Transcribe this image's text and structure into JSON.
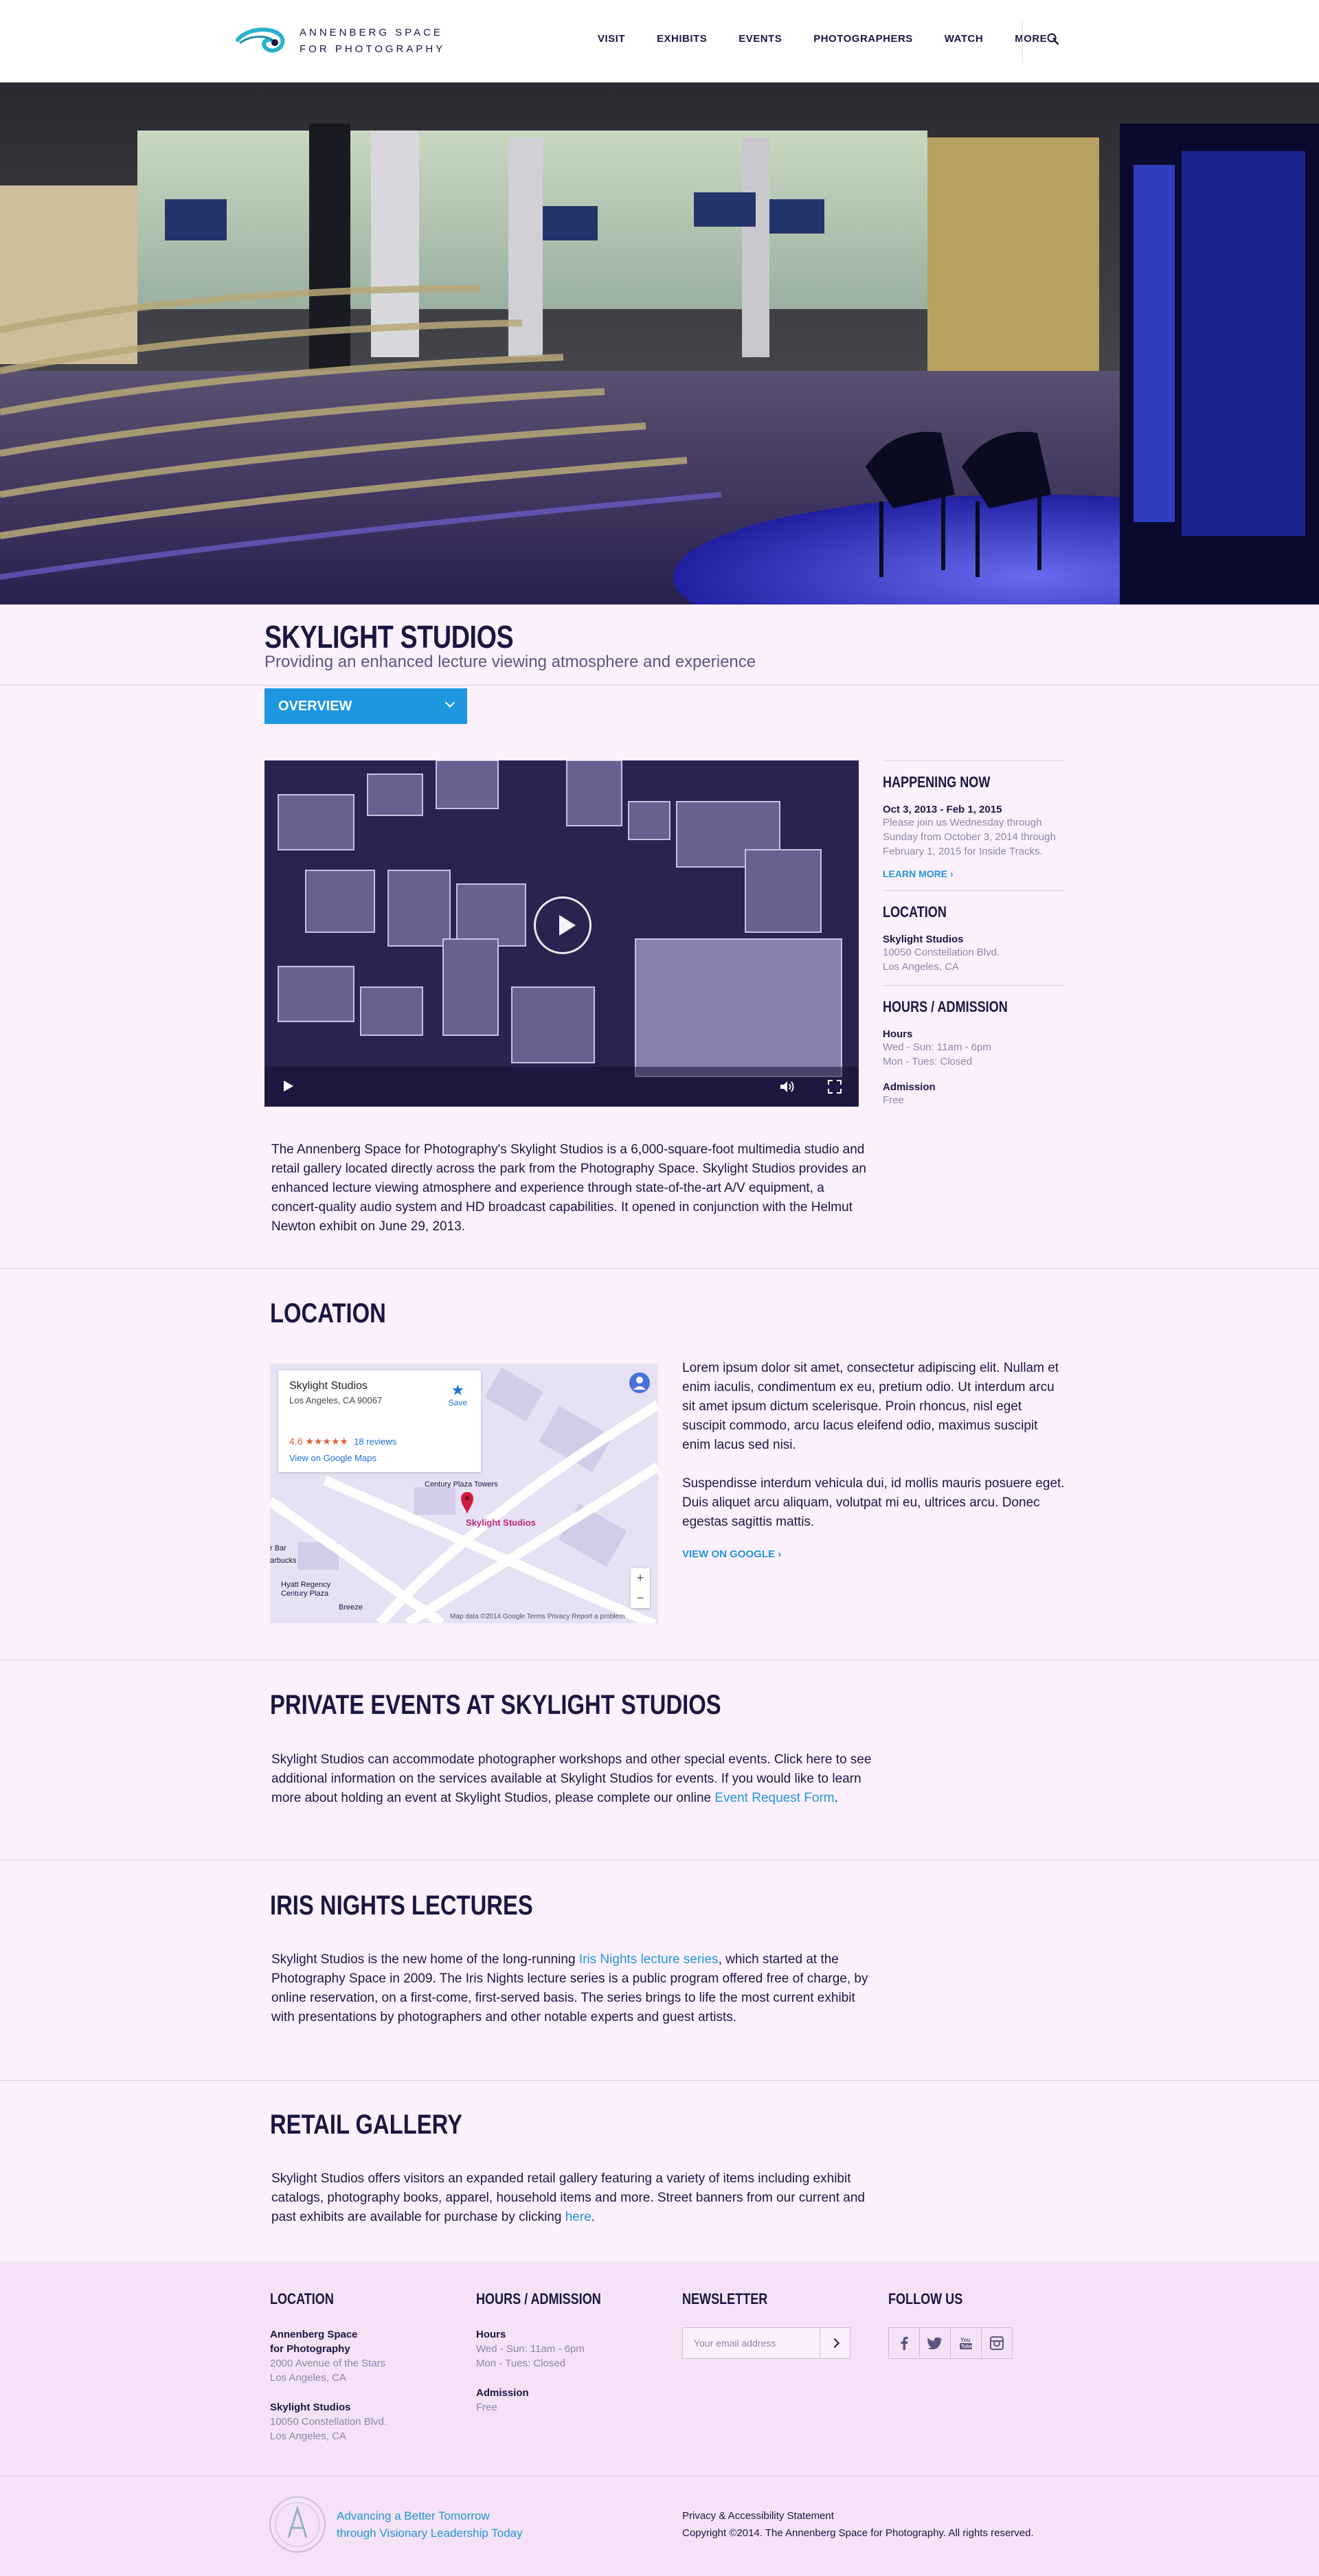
{
  "header": {
    "logo_line1": "ANNENBERG SPACE",
    "logo_line2": "FOR PHOTOGRAPHY",
    "nav": [
      "VISIT",
      "EXHIBITS",
      "EVENTS",
      "PHOTOGRAPHERS",
      "WATCH",
      "MORE"
    ],
    "icons": [
      "chevron-down-icon",
      "search-icon"
    ]
  },
  "page": {
    "title": "SKYLIGHT STUDIOS",
    "subtitle": "Providing an enhanced lecture viewing atmosphere and experience",
    "section_select": "OVERVIEW",
    "intro": "The Annenberg Space for Photography's Skylight Studios is a 6,000-square-foot multimedia studio and retail gallery located directly across the park from the Photography Space. Skylight Studios provides an enhanced lecture viewing atmosphere and experience through state-of-the-art A/V equipment, a concert-quality audio system and HD broadcast capabilities.  It opened in conjunction with the Helmut Newton exhibit on June 29, 2013."
  },
  "video": {
    "icons": [
      "play-icon",
      "volume-icon",
      "fullscreen-icon"
    ]
  },
  "sidebar": {
    "happening": {
      "heading": "HAPPENING NOW",
      "dates": "Oct 3, 2013 - Feb 1, 2015",
      "text": "Please join us Wednesday through Sunday from October 3, 2014 through February 1, 2015 for Inside Tracks.",
      "link": "LEARN MORE"
    },
    "location": {
      "heading": "LOCATION",
      "name": "Skylight Studios",
      "addr1": "10050 Constellation Blvd.",
      "addr2": "Los Angeles, CA"
    },
    "hours": {
      "heading": "HOURS / ADMISSION",
      "hours_label": "Hours",
      "hours1": "Wed - Sun: 11am - 6pm",
      "hours2": "Mon - Tues: Closed",
      "admission_label": "Admission",
      "admission": "Free"
    }
  },
  "location_section": {
    "title": "LOCATION",
    "map": {
      "card_title": "Skylight Studios",
      "card_addr": "Los Angeles, CA 90067",
      "rating": "4.6 ★★★★★",
      "reviews": "18 reviews",
      "google_link": "View on Google Maps",
      "save": "Save",
      "pin_label": "Skylight Studios",
      "footer": "Map data ©2014 Google    Terms    Privacy    Report a problem"
    },
    "para1": "Lorem ipsum dolor sit amet, consectetur adipiscing elit. Nullam et enim iaculis, condimentum ex eu, pretium odio. Ut interdum arcu sit amet ipsum dictum scelerisque. Proin rhoncus, nisl eget suscipit commodo, arcu lacus eleifend odio, maximus suscipit enim lacus sed nisi.",
    "para2": "Suspendisse interdum vehicula dui, id mollis mauris posuere eget. Duis aliquet arcu aliquam, volutpat mi eu, ultrices arcu. Donec egestas sagittis mattis.",
    "link": "VIEW ON GOOGLE"
  },
  "private_events": {
    "title": "PRIVATE EVENTS AT SKYLIGHT STUDIOS",
    "text": "Skylight Studios can accommodate photographer workshops and other special events. Click here to see additional information on the services available at Skylight Studios for events.  If you would like to learn more about holding an event at Skylight Studios, please complete our online ",
    "link": "Event Request Form",
    "end": "."
  },
  "iris": {
    "title": "IRIS NIGHTS LECTURES",
    "text1": "Skylight Studios is the new home of the long-running ",
    "link": "Iris Nights lecture series",
    "text2": ", which started at the Photography Space in 2009. The Iris Nights lecture series is a public program offered free of charge, by online reservation, on a first-come, first-served basis. The series brings to life the most current exhibit with presentations by photographers and other notable experts and guest artists."
  },
  "retail": {
    "title": "RETAIL GALLERY",
    "text": "Skylight Studios offers visitors an expanded retail gallery featuring a variety of items including exhibit catalogs, photography books, apparel, household items and more.  Street banners from our current and past exhibits are available for purchase by clicking ",
    "link": "here",
    "end": "."
  },
  "footer": {
    "location": {
      "heading": "LOCATION",
      "p1_name1": "Annenberg Space",
      "p1_name2": "for Photography",
      "p1_addr1": "2000 Avenue of the Stars",
      "p1_addr2": "Los Angeles, CA",
      "p2_name": "Skylight Studios",
      "p2_addr1": "10050 Constellation Blvd.",
      "p2_addr2": "Los Angeles, CA"
    },
    "hours": {
      "heading": "HOURS / ADMISSION",
      "hours_label": "Hours",
      "hours1": "Wed - Sun: 11am - 6pm",
      "hours2": "Mon - Tues: Closed",
      "admission_label": "Admission",
      "admission": "Free"
    },
    "newsletter": {
      "heading": "NEWSLETTER",
      "placeholder": "Your email address"
    },
    "follow": {
      "heading": "FOLLOW US",
      "icons": [
        "facebook-icon",
        "twitter-icon",
        "youtube-icon",
        "instagram-icon"
      ]
    },
    "tagline1": "Advancing a Better Tomorrow",
    "tagline2": "through Visionary Leadership Today",
    "privacy": "Privacy & Accessibility Statement",
    "copyright": "Copyright ©2014. The Annenberg Space for Photography. All rights reserved."
  },
  "colors": {
    "accent": "#2196d6",
    "navy": "#1a1640",
    "page_bg": "#fdf0fd"
  }
}
